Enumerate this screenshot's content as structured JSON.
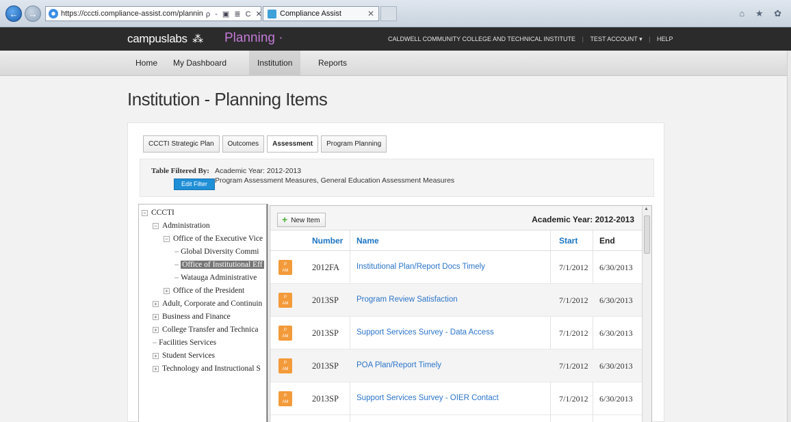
{
  "browser": {
    "url": "https://cccti.compliance-assist.com/plannin",
    "address_tools": "ρ - ▣ ≣ C ✕",
    "tab_title": "Compliance Assist",
    "tab_close": "✕",
    "right_icons": "⌂ ★ ✿"
  },
  "header": {
    "brand": "campuslabs",
    "brand_logo": "⁂",
    "app_name": "Planning ·",
    "institution": "CALDWELL COMMUNITY COLLEGE AND TECHNICAL INSTITUTE",
    "account": "TEST ACCOUNT ▾",
    "help": "HELP"
  },
  "nav": {
    "items": [
      "Home",
      "My Dashboard",
      "Institution",
      "Reports"
    ]
  },
  "page": {
    "title": "Institution - Planning Items"
  },
  "tabs": [
    "CCCTI Strategic Plan",
    "Outcomes",
    "Assessment",
    "Program Planning"
  ],
  "filter": {
    "label": "Table Filtered By:",
    "line1": "Academic Year: 2012-2013",
    "line2": "Program Assessment Measures, General Education Assessment Measures",
    "edit_button": "Edit Filter"
  },
  "tree": {
    "nodes": [
      {
        "label": "CCCTI",
        "exp": "−"
      },
      {
        "label": "Administration",
        "exp": "−"
      },
      {
        "label": "Office of the Executive Vice",
        "exp": "−"
      },
      {
        "label": "Global Diversity Commi",
        "exp": ""
      },
      {
        "label": "Office of Institutional Eff",
        "exp": ""
      },
      {
        "label": "Watauga Administrative",
        "exp": ""
      },
      {
        "label": "Office of the President",
        "exp": "+"
      },
      {
        "label": "Adult, Corporate and Continuin",
        "exp": "+"
      },
      {
        "label": "Business and Finance",
        "exp": "+"
      },
      {
        "label": "College Transfer and Technica",
        "exp": "+"
      },
      {
        "label": "Facilities Services",
        "exp": ""
      },
      {
        "label": "Student Services",
        "exp": "+"
      },
      {
        "label": "Technology and Instructional S",
        "exp": "+"
      }
    ]
  },
  "table": {
    "new_item": "New Item",
    "plus_glyph": "+",
    "academic_year": "Academic Year: 2012-2013",
    "columns": {
      "number": "Number",
      "name": "Name",
      "start": "Start",
      "end": "End"
    },
    "badge_line1": "P",
    "badge_line2": "AM",
    "badge_color": "#f39a3a",
    "rows": [
      {
        "number": "2012FA",
        "name": "Institutional Plan/Report Docs Timely",
        "start": "7/1/2012",
        "end": "6/30/2013"
      },
      {
        "number": "2013SP",
        "name": "Program Review Satisfaction",
        "start": "7/1/2012",
        "end": "6/30/2013"
      },
      {
        "number": "2013SP",
        "name": "Support Services Survey - Data Access",
        "start": "7/1/2012",
        "end": "6/30/2013"
      },
      {
        "number": "2013SP",
        "name": "POA Plan/Report Timely",
        "start": "7/1/2012",
        "end": "6/30/2013"
      },
      {
        "number": "2013SP",
        "name": "Support Services Survey - OIER Contact",
        "start": "7/1/2012",
        "end": "6/30/2013"
      }
    ]
  }
}
